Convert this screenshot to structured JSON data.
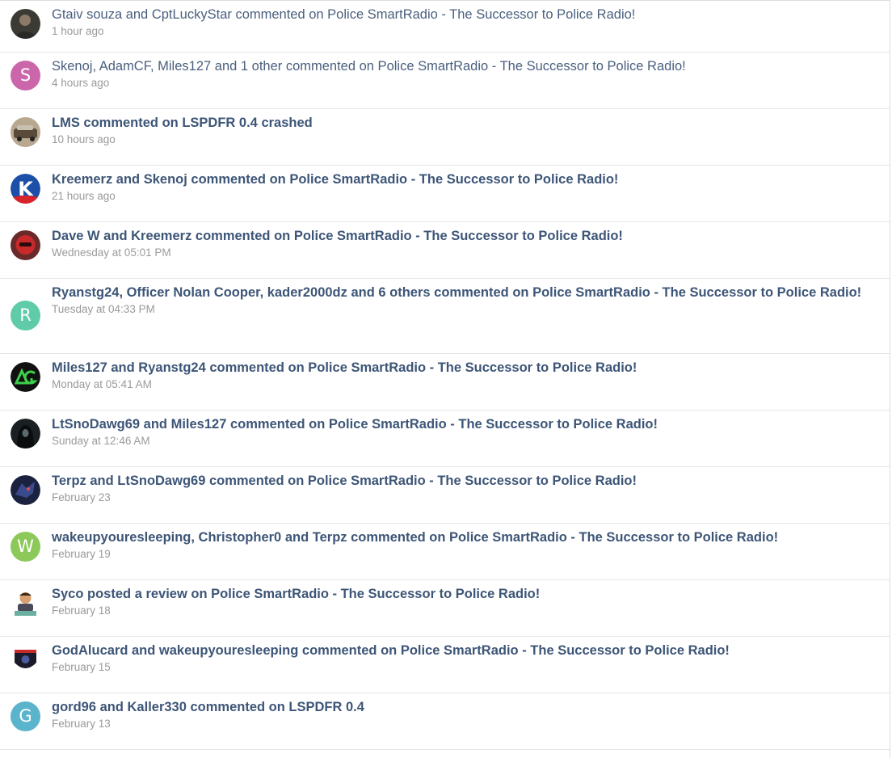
{
  "activity": [
    {
      "avatar": "photo-icon",
      "letter": "",
      "color": "",
      "text": "Gtaiv souza and CptLuckyStar commented on Police SmartRadio - The Successor to Police Radio!",
      "time": "1 hour ago",
      "read": true
    },
    {
      "avatar": "letter",
      "letter": "S",
      "color": "#cc66aa",
      "text": "Skenoj, AdamCF, Miles127 and 1 other commented on Police SmartRadio - The Successor to Police Radio!",
      "time": "4 hours ago",
      "read": true
    },
    {
      "avatar": "photo-icon",
      "letter": "",
      "color": "",
      "text": "LMS commented on LSPDFR 0.4 crashed",
      "time": "10 hours ago",
      "read": false
    },
    {
      "avatar": "k-logo-icon",
      "letter": "",
      "color": "",
      "text": "Kreemerz and Skenoj commented on Police SmartRadio - The Successor to Police Radio!",
      "time": "21 hours ago",
      "read": false
    },
    {
      "avatar": "red-helmet-icon",
      "letter": "",
      "color": "",
      "text": "Dave W and Kreemerz commented on Police SmartRadio - The Successor to Police Radio!",
      "time": "Wednesday at 05:01 PM",
      "read": false
    },
    {
      "avatar": "letter",
      "letter": "R",
      "color": "#5fcba8",
      "text": "Ryanstg24, Officer Nolan Cooper, kader2000dz and 6 others commented on Police SmartRadio - The Successor to Police Radio!",
      "time": "Tuesday at 04:33 PM",
      "read": false
    },
    {
      "avatar": "ag-logo-icon",
      "letter": "",
      "color": "",
      "text": "Miles127 and Ryanstg24 commented on Police SmartRadio - The Successor to Police Radio!",
      "time": "Monday at 05:41 AM",
      "read": false
    },
    {
      "avatar": "hooded-figure-icon",
      "letter": "",
      "color": "",
      "text": "LtSnoDawg69 and Miles127 commented on Police SmartRadio - The Successor to Police Radio!",
      "time": "Sunday at 12:46 AM",
      "read": false
    },
    {
      "avatar": "dragon-icon",
      "letter": "",
      "color": "",
      "text": "Terpz and LtSnoDawg69 commented on Police SmartRadio - The Successor to Police Radio!",
      "time": "February 23",
      "read": false
    },
    {
      "avatar": "letter",
      "letter": "W",
      "color": "#8cc85a",
      "text": "wakeupyouresleeping, Christopher0 and Terpz commented on Police SmartRadio - The Successor to Police Radio!",
      "time": "February 19",
      "read": false
    },
    {
      "avatar": "cartoon-person-icon",
      "letter": "",
      "color": "",
      "text": "Syco posted a review on Police SmartRadio - The Successor to Police Radio!",
      "time": "February 18",
      "read": false
    },
    {
      "avatar": "badge-icon",
      "letter": "",
      "color": "",
      "text": "GodAlucard and wakeupyouresleeping commented on Police SmartRadio - The Successor to Police Radio!",
      "time": "February 15",
      "read": false
    },
    {
      "avatar": "letter",
      "letter": "G",
      "color": "#5ab4cc",
      "text": "gord96 and Kaller330 commented on LSPDFR 0.4",
      "time": "February 13",
      "read": false
    }
  ]
}
